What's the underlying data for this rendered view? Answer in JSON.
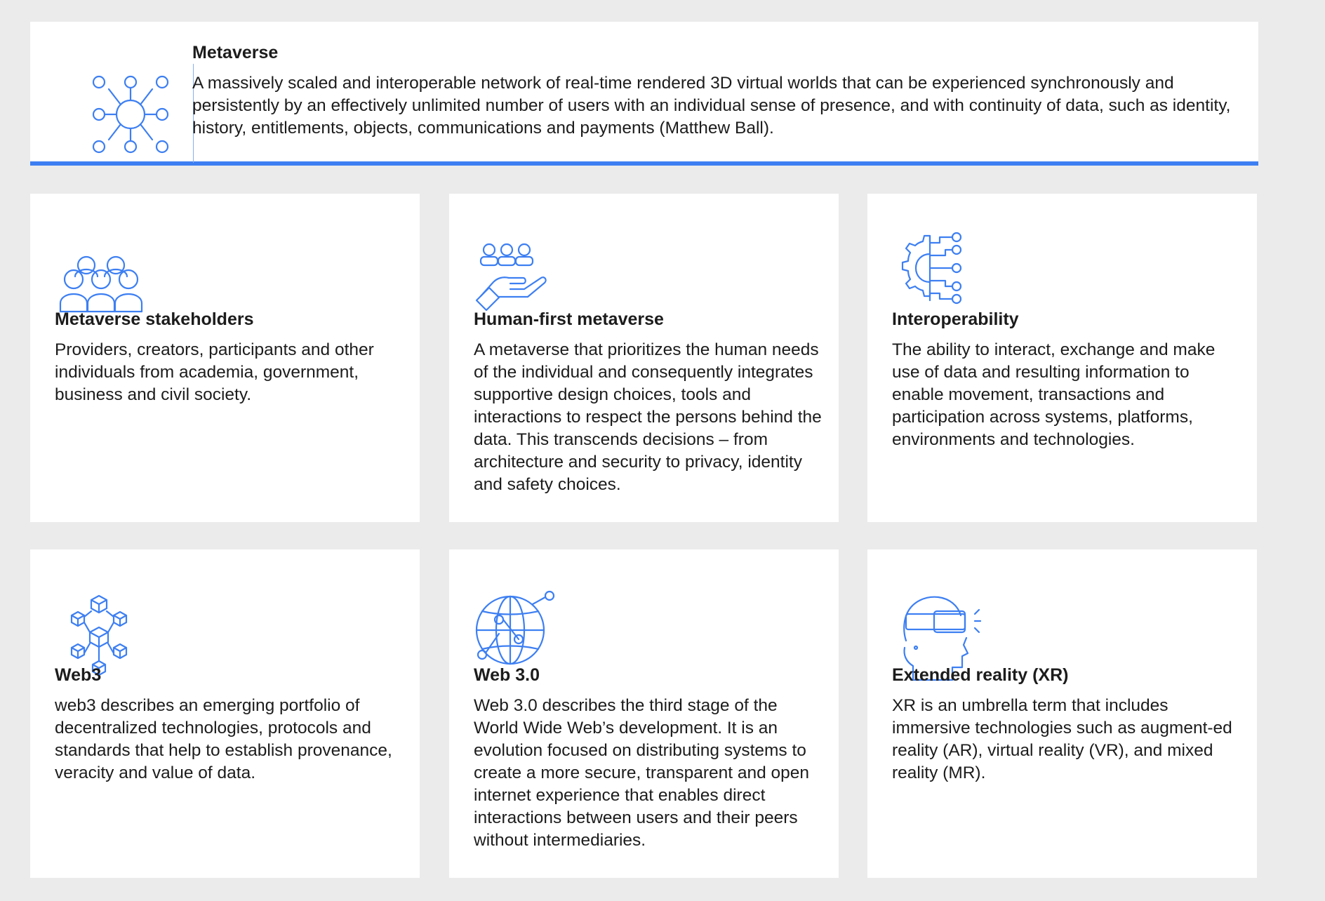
{
  "accent_color": "#3d7ff2",
  "header": {
    "icon": "network-hub-icon",
    "title": "Metaverse",
    "text": "A massively scaled and interoperable network of real-time rendered 3D virtual worlds that can be experienced synchronously and persistently by an effectively unlimited number of users with an individual sense of presence, and with continuity of data, such as identity, history, entitlements, objects, communications and payments (Matthew Ball)."
  },
  "cards": [
    {
      "icon": "people-group-icon",
      "title": "Metaverse stakeholders",
      "text": "Providers, creators, participants and other individuals from academia, government, business and civil society."
    },
    {
      "icon": "hand-holding-people-icon",
      "title": "Human-first metaverse",
      "text": "A metaverse that prioritizes the human needs of the individual and consequently integrates supportive design choices, tools and interactions to respect the persons behind the data. This transcends decisions – from architecture and security to privacy, identity and safety choices."
    },
    {
      "icon": "gear-circuit-icon",
      "title": "Interoperability",
      "text": "The ability to interact, exchange and make use of data and resulting information to enable movement, transactions and participation across systems, platforms, environments and technologies."
    },
    {
      "icon": "blockchain-cubes-icon",
      "title": "Web3",
      "text": "web3 describes an emerging portfolio of decentralized technologies, protocols and standards that help to establish provenance, veracity and value of data."
    },
    {
      "icon": "globe-network-icon",
      "title": "Web 3.0",
      "text": "Web 3.0 describes the third stage of the World Wide Web’s development. It is an evolution focused on distributing systems to create a more secure, transparent and open internet experience that enables direct interactions between users and their peers without intermediaries."
    },
    {
      "icon": "vr-headset-icon",
      "title": "Extended reality (XR)",
      "text": "XR is an umbrella term that includes immersive technologies such as augment-ed reality (AR), virtual reality (VR), and mixed reality (MR)."
    }
  ]
}
